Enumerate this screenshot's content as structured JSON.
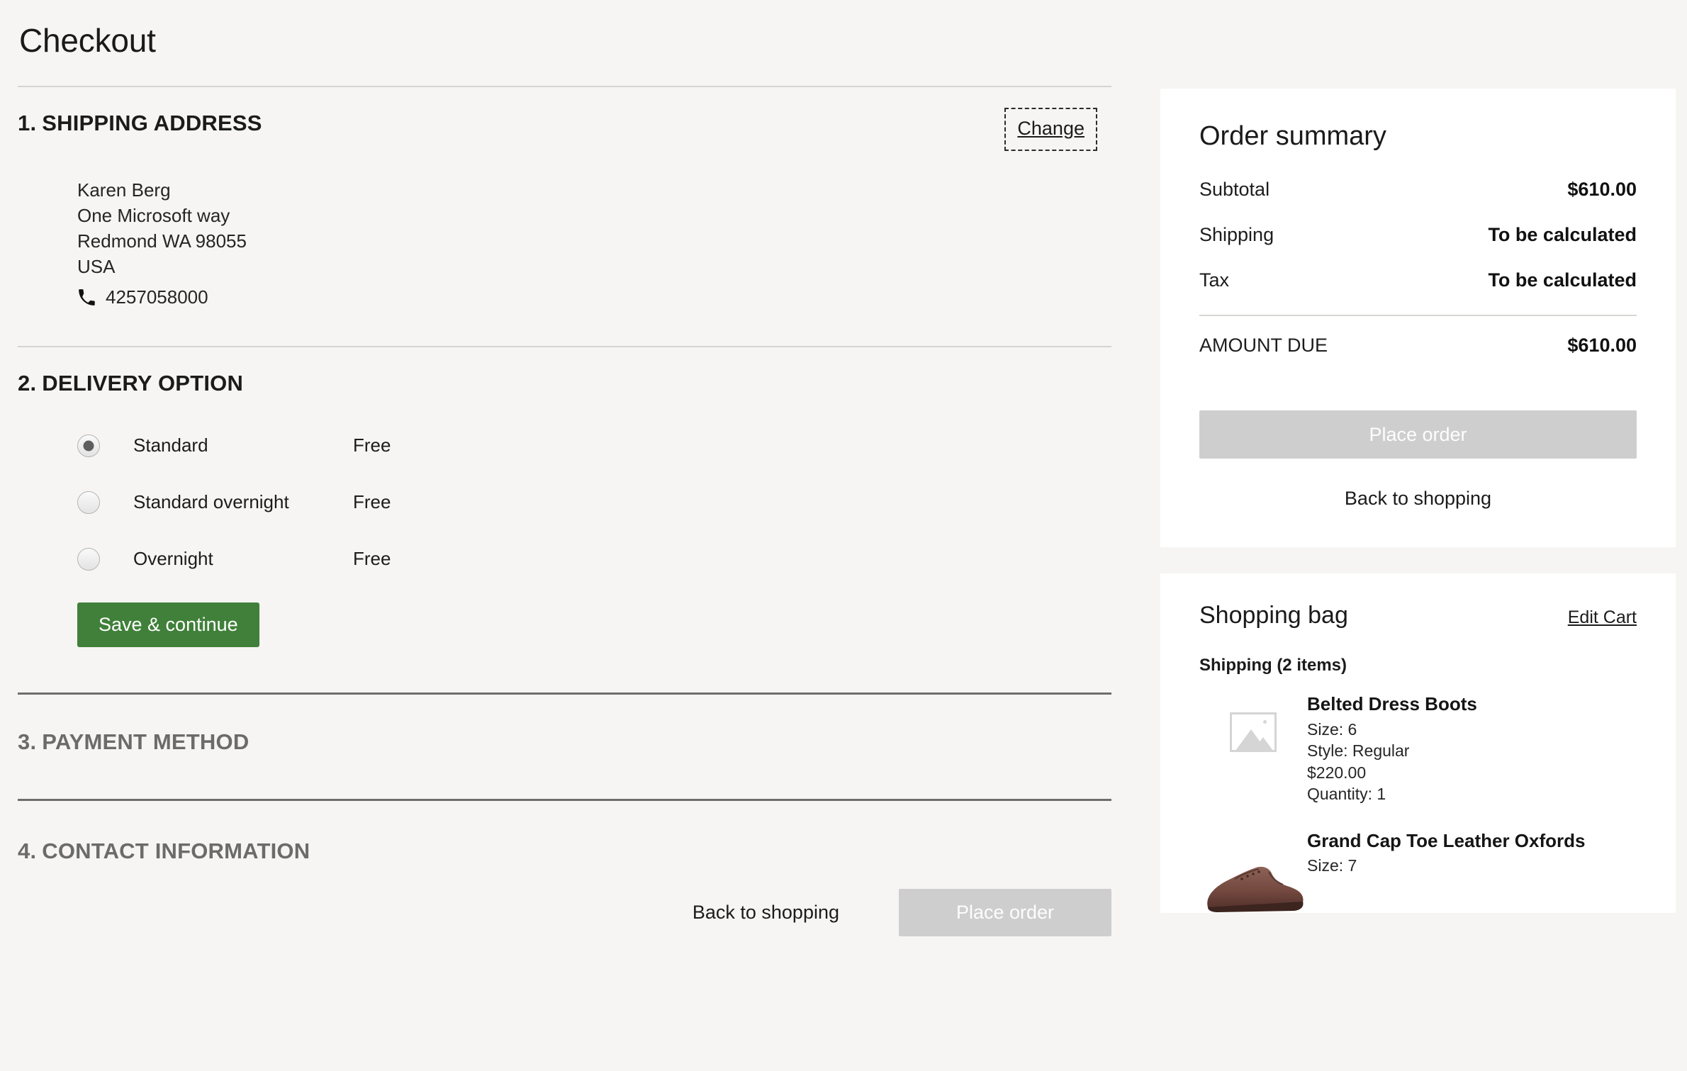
{
  "header": {
    "title": "Checkout"
  },
  "shipping": {
    "section_number": "1.",
    "section_title": "SHIPPING ADDRESS",
    "change_label": "Change",
    "address": {
      "name": "Karen Berg",
      "street": "One Microsoft way",
      "city_state_zip": "Redmond WA  98055",
      "country": "USA",
      "phone": "4257058000",
      "phone_icon": "phone-icon"
    }
  },
  "delivery": {
    "section_number": "2.",
    "section_title": "DELIVERY OPTION",
    "options": [
      {
        "label": "Standard",
        "price": "Free",
        "selected": true
      },
      {
        "label": "Standard overnight",
        "price": "Free",
        "selected": false
      },
      {
        "label": "Overnight",
        "price": "Free",
        "selected": false
      }
    ],
    "save_label": "Save & continue",
    "save_color": "#40803a"
  },
  "payment": {
    "section_number": "3.",
    "section_title": "PAYMENT METHOD"
  },
  "contact": {
    "section_number": "4.",
    "section_title": "CONTACT INFORMATION"
  },
  "bottom_actions": {
    "back_label": "Back to shopping",
    "place_order_label": "Place order",
    "place_order_disabled_color": "#cecece"
  },
  "order_summary": {
    "title": "Order summary",
    "rows": [
      {
        "label": "Subtotal",
        "value": "$610.00"
      },
      {
        "label": "Shipping",
        "value": "To be calculated"
      },
      {
        "label": "Tax",
        "value": "To be calculated"
      }
    ],
    "total": {
      "label": "AMOUNT DUE",
      "value": "$610.00"
    },
    "place_order_label": "Place order",
    "back_label": "Back to shopping"
  },
  "shopping_bag": {
    "title": "Shopping bag",
    "edit_label": "Edit Cart",
    "group_label": "Shipping (2 items)",
    "items": [
      {
        "name": "Belted Dress Boots",
        "size": "Size: 6",
        "style": "Style: Regular",
        "price": "$220.00",
        "quantity": "Quantity: 1",
        "thumb": "image-placeholder-icon"
      },
      {
        "name": "Grand Cap Toe Leather Oxfords",
        "size": "Size: 7",
        "thumb": "leather-oxford-shoe-photo"
      }
    ]
  }
}
